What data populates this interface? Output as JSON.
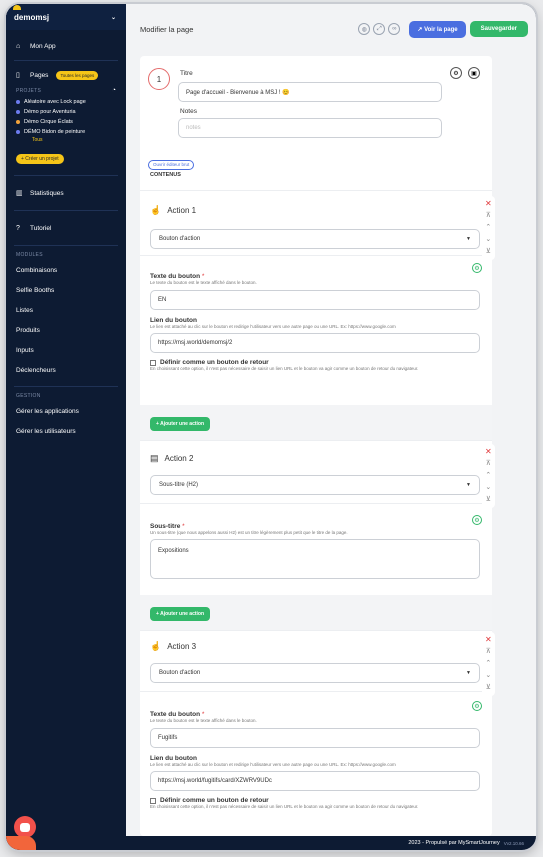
{
  "app": {
    "name": "demomsj"
  },
  "sidebar": {
    "my_app": "Mon App",
    "pages": "Pages",
    "all_pages": "Toutes les pages",
    "projects_title": "PROJETS",
    "projects": [
      {
        "name": "Aléatoire avec Lock page",
        "color": "#6d7cf0"
      },
      {
        "name": "Démo pour Aventuria",
        "color": "#6d7cf0"
      },
      {
        "name": "Démo Cirque Éclats",
        "color": "#f2a33b"
      },
      {
        "name": "DÉMO Bidon de peinture",
        "color": "#6d7cf0"
      }
    ],
    "all": "Tous",
    "create_project": "+ Créer un projet",
    "stats": "Statistiques",
    "tutorial": "Tutoriel",
    "modules_title": "MODULES",
    "modules": [
      "Combinaisons",
      "Selfie Booths",
      "Listes",
      "Produits",
      "Inputs",
      "Déclencheurs"
    ],
    "gestion_title": "GESTION",
    "gestion": [
      "Gérer les applications",
      "Gérer les utilisateurs"
    ]
  },
  "topbar": {
    "title": "Modifier la page",
    "view_page": "Voir la page",
    "save": "Sauvegarder"
  },
  "page": {
    "number": "1",
    "title_label": "Titre",
    "title_value": "Page d'accueil - Bienvenue à MSJ ! 😊",
    "notes_label": "Notes",
    "notes_placeholder": "notes",
    "raw_editor": "Ouvrir éditeur brut",
    "content_label": "CONTENUS"
  },
  "actions": [
    {
      "title": "Action 1",
      "type": "Bouton d'action",
      "text_label": "Texte du bouton",
      "text_help": "Le texte du bouton est le texte affiché dans le bouton.",
      "text_value": "EN",
      "link_label": "Lien du bouton",
      "link_help": "Le lien est attaché au clic sur le bouton et redirige l'utilisateur vers une autre page ou une URL. Ex: https://www.google.com",
      "link_value": "https://msj.world/demomsj/2",
      "back_label": "Définir comme un bouton de retour",
      "back_help": "En choisissant cette option, il n'est pas nécessaire de saisir un lien URL et le bouton va agir comme un bouton de retour du navigateur."
    },
    {
      "title": "Action 2",
      "type": "Sous-titre (H2)",
      "sub_label": "Sous-titre",
      "sub_help": "Un sous-titre (que nous appelons aussi H2) est un titre légèrement plus petit que le titre de la page.",
      "sub_value": "Expositions"
    },
    {
      "title": "Action 3",
      "type": "Bouton d'action",
      "text_label": "Texte du bouton",
      "text_help": "Le texte du bouton est le texte affiché dans le bouton.",
      "text_value": "Fugitifs",
      "link_label": "Lien du bouton",
      "link_help": "Le lien est attaché au clic sur le bouton et redirige l'utilisateur vers une autre page ou une URL. Ex: https://www.google.com",
      "link_value": "https://msj.world/fugitifs/card/XZWRV9UDc",
      "back_label": "Définir comme un bouton de retour",
      "back_help": "En choisissant cette option, il n'est pas nécessaire de saisir un lien URL et le bouton va agir comme un bouton de retour du navigateur."
    }
  ],
  "add_action": "+ Ajouter une action",
  "footer": {
    "text": "2023 - Propulsé par MySmartJourney",
    "version": "Vv2.10.66"
  }
}
